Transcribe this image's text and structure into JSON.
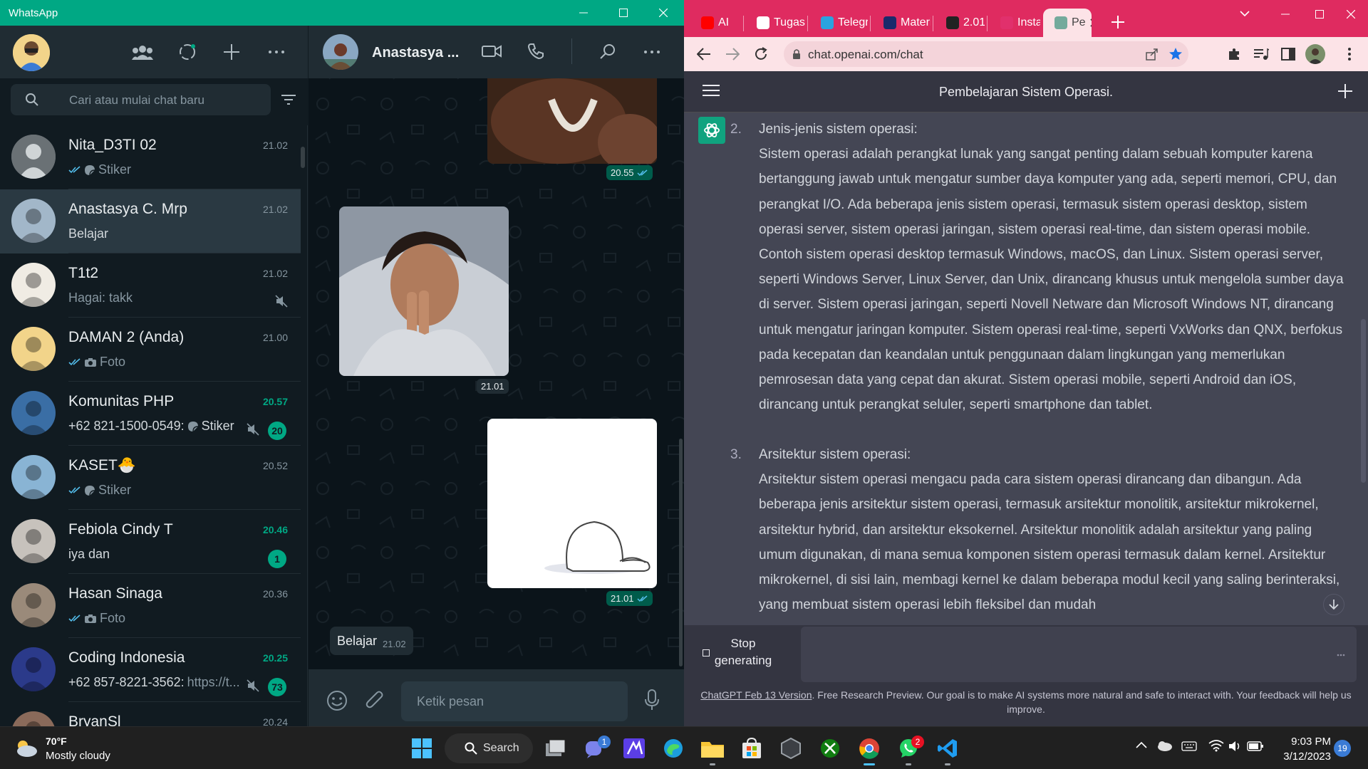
{
  "whatsapp": {
    "window_title": "WhatsApp",
    "search_placeholder": "Cari atau mulai chat baru",
    "chats": [
      {
        "name": "Nita_D3TI 02",
        "time": "21.02",
        "sub": "Stiker",
        "ticks": true,
        "icon": "sticker-icon",
        "sender": "",
        "muted": false,
        "unread": "",
        "time_green": false
      },
      {
        "name": "Anastasya C. Mrp",
        "time": "21.02",
        "sub": "Belajar",
        "ticks": false,
        "icon": "",
        "sender": "",
        "muted": false,
        "unread": "",
        "time_green": false,
        "active": true
      },
      {
        "name": "T1t2",
        "time": "21.02",
        "sub": "Hagai: takk",
        "ticks": false,
        "icon": "",
        "sender": "",
        "muted": true,
        "unread": "",
        "time_green": false
      },
      {
        "name": "DAMAN 2 (Anda)",
        "time": "21.00",
        "sub": "Foto",
        "ticks": true,
        "icon": "camera-icon",
        "sender": "",
        "muted": false,
        "unread": "",
        "time_green": false
      },
      {
        "name": "Komunitas PHP",
        "time": "20.57",
        "sub": "Stiker",
        "ticks": false,
        "icon": "sticker-icon",
        "sender": "+62 821-1500-0549:",
        "muted": true,
        "unread": "20",
        "time_green": true
      },
      {
        "name": "KASET🐣",
        "time": "20.52",
        "sub": "Stiker",
        "ticks": true,
        "icon": "sticker-icon",
        "sender": "",
        "muted": false,
        "unread": "",
        "time_green": false
      },
      {
        "name": "Febiola Cindy T",
        "time": "20.46",
        "sub": "iya dan",
        "ticks": false,
        "icon": "",
        "sender": "",
        "muted": false,
        "unread": "1",
        "time_green": true
      },
      {
        "name": "Hasan Sinaga",
        "time": "20.36",
        "sub": "Foto",
        "ticks": true,
        "icon": "camera-icon",
        "sender": "",
        "muted": false,
        "unread": "",
        "time_green": false
      },
      {
        "name": "Coding Indonesia",
        "time": "20.25",
        "sub": "https://t...",
        "ticks": false,
        "icon": "",
        "sender": "+62 857-8221-3562:",
        "muted": true,
        "unread": "73",
        "time_green": true
      },
      {
        "name": "BryanSl",
        "time": "20.24",
        "sub": "",
        "ticks": false,
        "icon": "",
        "sender": "",
        "muted": false,
        "unread": "",
        "time_green": false
      }
    ],
    "conversation": {
      "contact_name": "Anastasya ...",
      "msg_time_1": "20.55",
      "msg_time_2": "21.01",
      "msg_time_3": "21.01",
      "text_msg": "Belajar",
      "text_msg_time": "21.02",
      "compose_placeholder": "Ketik pesan"
    }
  },
  "chrome": {
    "tabs": [
      {
        "label": "AI",
        "color": "#ff0000"
      },
      {
        "label": "Tugas",
        "color": "#ffffff"
      },
      {
        "label": "Telegram",
        "color": "#2aa3df"
      },
      {
        "label": "Materi",
        "color": "#1b2a6b"
      },
      {
        "label": "2.01",
        "color": "#222222"
      },
      {
        "label": "Instagram",
        "color": "#e1306c"
      },
      {
        "label": "Pe",
        "color": "#74aa9c"
      }
    ],
    "url": "chat.openai.com/chat",
    "accent": "#df2b60"
  },
  "chatgpt": {
    "title": "Pembelajaran Sistem Operasi.",
    "items": [
      {
        "num": "2.",
        "heading": "Jenis-jenis sistem operasi:",
        "body": "Sistem operasi adalah perangkat lunak yang sangat penting dalam sebuah komputer karena bertanggung jawab untuk mengatur sumber daya komputer yang ada, seperti memori, CPU, dan perangkat I/O. Ada beberapa jenis sistem operasi, termasuk sistem operasi desktop, sistem operasi server, sistem operasi jaringan, sistem operasi real-time, dan sistem operasi mobile. Contoh sistem operasi desktop termasuk Windows, macOS, dan Linux. Sistem operasi server, seperti Windows Server, Linux Server, dan Unix, dirancang khusus untuk mengelola sumber daya di server. Sistem operasi jaringan, seperti Novell Netware dan Microsoft Windows NT, dirancang untuk mengatur jaringan komputer. Sistem operasi real-time, seperti VxWorks dan QNX, berfokus pada kecepatan dan keandalan untuk penggunaan dalam lingkungan yang memerlukan pemrosesan data yang cepat dan akurat. Sistem operasi mobile, seperti Android dan iOS, dirancang untuk perangkat seluler, seperti smartphone dan tablet."
      },
      {
        "num": "3.",
        "heading": "Arsitektur sistem operasi:",
        "body": "Arsitektur sistem operasi mengacu pada cara sistem operasi dirancang dan dibangun. Ada beberapa jenis arsitektur sistem operasi, termasuk arsitektur monolitik, arsitektur mikrokernel, arsitektur hybrid, dan arsitektur eksokernel. Arsitektur monolitik adalah arsitektur yang paling umum digunakan, di mana semua komponen sistem operasi termasuk dalam kernel. Arsitektur mikrokernel, di sisi lain, membagi kernel ke dalam beberapa modul kecil yang saling berinteraksi, yang membuat sistem operasi lebih fleksibel dan mudah"
      }
    ],
    "stop_label": "Stop generating",
    "footer_link": "ChatGPT Feb 13 Version",
    "footer_text": ". Free Research Preview. Our goal is to make AI systems more natural and safe to interact with. Your feedback will help us improve."
  },
  "taskbar": {
    "weather_temp": "70°F",
    "weather_desc": "Mostly cloudy",
    "search_label": "Search",
    "time": "9:03 PM",
    "date": "3/12/2023",
    "notifications": "19",
    "teams_badge": "1",
    "whatsapp_badge": "2"
  }
}
